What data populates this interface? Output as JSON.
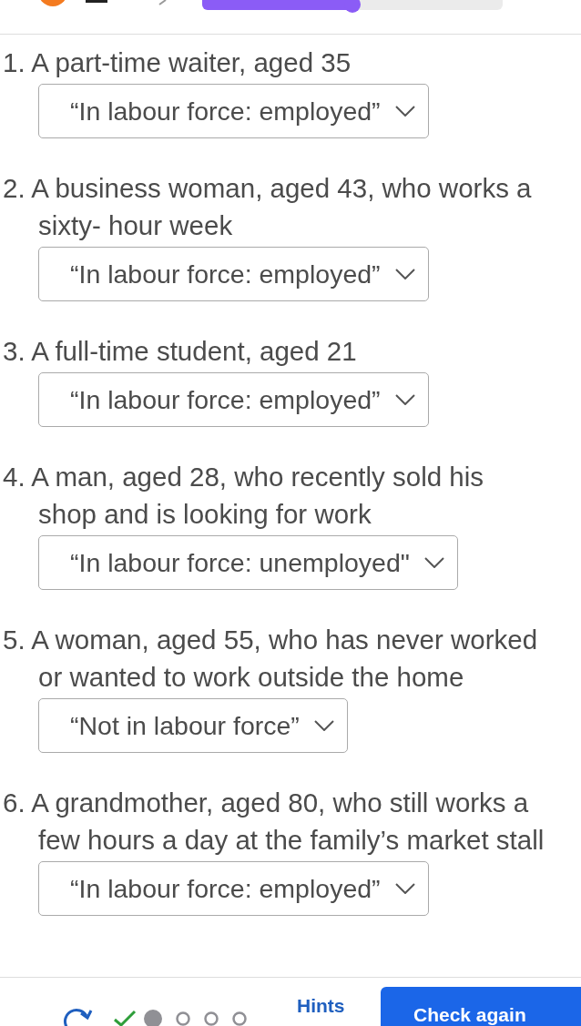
{
  "progress": {
    "level": 0.5
  },
  "questions": [
    {
      "text": "1. A part-time waiter, aged 35",
      "answer": "“In labour force: employed”"
    },
    {
      "text": "2. A business woman, aged 43, who works a sixty- hour week",
      "answer": "“In labour force: employed”"
    },
    {
      "text": "3. A full-time student, aged 21",
      "answer": "“In labour force: employed”"
    },
    {
      "text": "4. A man, aged 28, who recently sold his shop and is looking for work",
      "answer": "“In labour force: unemployed\""
    },
    {
      "text": "5. A woman, aged 55, who has never worked or wanted to work outside the home",
      "answer": "“Not in labour force”"
    },
    {
      "text": "6. A grandmother, aged 80, who still works a few hours a day at the family’s market stall",
      "answer": "“In labour force: employed”"
    }
  ],
  "steps": [
    {
      "kind": "done"
    },
    {
      "kind": "current"
    },
    {
      "kind": "pending"
    },
    {
      "kind": "pending"
    },
    {
      "kind": "pending"
    }
  ],
  "footer": {
    "hints": "Hints",
    "check": "Check again"
  }
}
